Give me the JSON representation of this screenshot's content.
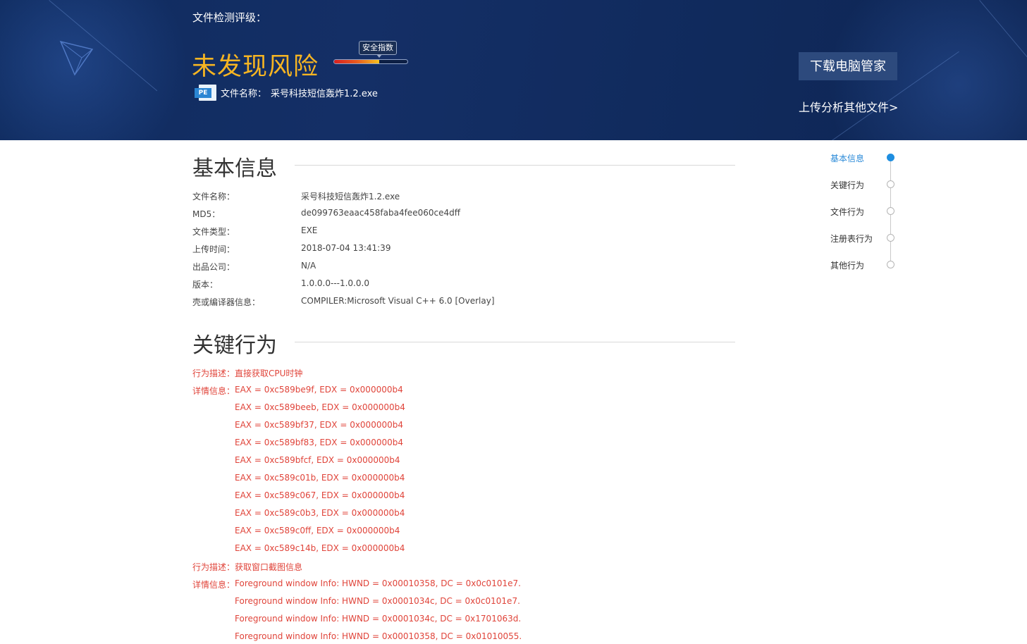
{
  "banner": {
    "scan_label": "文件检测评级：",
    "verdict": "未发现风险",
    "safety_index_label": "安全指数",
    "safety_index_level": 0.62,
    "file_name_label": "文件名称：",
    "file_name": "采号科技短信轰炸1.2.exe",
    "file_type_icon_text": "PE",
    "download_button": "下载电脑管家",
    "upload_link": "上传分析其他文件>"
  },
  "basic_info": {
    "title": "基本信息",
    "rows": [
      {
        "key": "文件名称：",
        "value": "采号科技短信轰炸1.2.exe"
      },
      {
        "key": "MD5：",
        "value": "de099763eaac458faba4fee060ce4dff"
      },
      {
        "key": "文件类型：",
        "value": "EXE"
      },
      {
        "key": "上传时间：",
        "value": "2018-07-04 13:41:39"
      },
      {
        "key": "出品公司：",
        "value": "N/A"
      },
      {
        "key": "版本：",
        "value": "1.0.0.0---1.0.0.0"
      },
      {
        "key": "壳或编译器信息：",
        "value": "COMPILER:Microsoft Visual C++ 6.0 [Overlay]"
      }
    ]
  },
  "key_behavior": {
    "title": "关键行为",
    "desc_label": "行为描述：",
    "detail_label": "详情信息：",
    "groups": [
      {
        "description": "直接获取CPU时钟",
        "details": [
          "EAX = 0xc589be9f, EDX = 0x000000b4",
          "EAX = 0xc589beeb, EDX = 0x000000b4",
          "EAX = 0xc589bf37, EDX = 0x000000b4",
          "EAX = 0xc589bf83, EDX = 0x000000b4",
          "EAX = 0xc589bfcf, EDX = 0x000000b4",
          "EAX = 0xc589c01b, EDX = 0x000000b4",
          "EAX = 0xc589c067, EDX = 0x000000b4",
          "EAX = 0xc589c0b3, EDX = 0x000000b4",
          "EAX = 0xc589c0ff, EDX = 0x000000b4",
          "EAX = 0xc589c14b, EDX = 0x000000b4"
        ]
      },
      {
        "description": "获取窗口截图信息",
        "details": [
          "Foreground window Info: HWND = 0x00010358, DC = 0x0c0101e7.",
          "Foreground window Info: HWND = 0x0001034c, DC = 0x0c0101e7.",
          "Foreground window Info: HWND = 0x0001034c, DC = 0x1701063d.",
          "Foreground window Info: HWND = 0x00010358, DC = 0x01010055."
        ]
      }
    ]
  },
  "side_nav": {
    "items": [
      {
        "label": "基本信息",
        "active": true
      },
      {
        "label": "关键行为",
        "active": false
      },
      {
        "label": "文件行为",
        "active": false
      },
      {
        "label": "注册表行为",
        "active": false
      },
      {
        "label": "其他行为",
        "active": false
      }
    ]
  },
  "colors": {
    "banner_bg": "#12306a",
    "verdict": "#f7b522",
    "behavior_text": "#e0443a",
    "nav_active": "#1e8ee0"
  }
}
